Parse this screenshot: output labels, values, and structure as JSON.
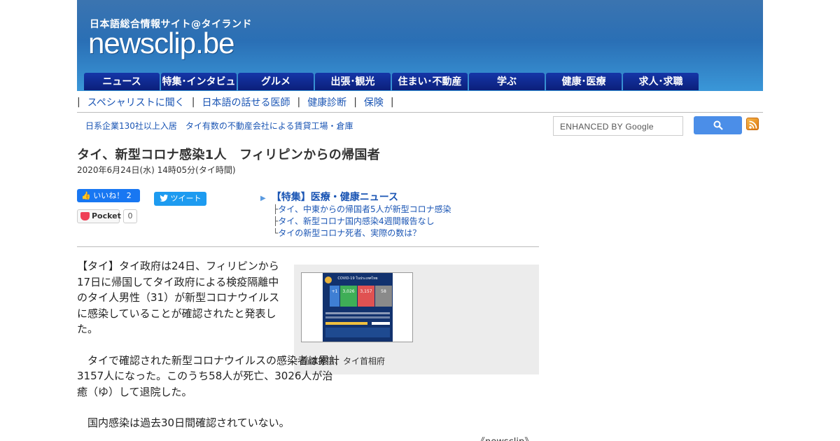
{
  "header": {
    "tagline": "日本語総合情報サイト@タイランド",
    "logo": "newsclip.be"
  },
  "nav": {
    "tabs": [
      {
        "label": "ニュース"
      },
      {
        "label": "特集･インタビュー"
      },
      {
        "label": "グルメ"
      },
      {
        "label": "出張･観光"
      },
      {
        "label": "住まい･不動産"
      },
      {
        "label": "学ぶ"
      },
      {
        "label": "健康･医療"
      },
      {
        "label": "求人･求職"
      }
    ]
  },
  "subnav": {
    "links": [
      {
        "label": "スペシャリストに聞く"
      },
      {
        "label": "日本語の話せる医師"
      },
      {
        "label": "健康診断"
      },
      {
        "label": "保険"
      }
    ]
  },
  "ad": {
    "text": "日系企業130社以上入居　タイ有数の不動産会社による賃貸工場・倉庫"
  },
  "search": {
    "placeholder": "ENHANCED BY Google",
    "icon": "search-icon"
  },
  "article": {
    "title": "タイ、新型コロナ感染1人　フィリピンからの帰国者",
    "date": "2020年6月24日(水) 14時05分(タイ時間)",
    "paragraphs": [
      "【タイ】タイ政府は24日、フィリピンから17日に帰国してタイ政府による検疫隔離中のタイ人男性（31）が新型コロナウイルスに感染していることが確認されたと発表した。",
      "　タイで確認された新型コロナウイルスの感染者は累計3157人になった。このうち58人が死亡、3026人が治癒（ゆ）して退院した。",
      "　国内感染は過去30日間確認されていない。"
    ],
    "source": "《newsclip》"
  },
  "social": {
    "like_label": "いいね！ 2",
    "tweet_label": "ツイート",
    "pocket_label": "Pocket",
    "pocket_count": "0"
  },
  "related": {
    "heading": "【特集】医療・健康ニュース",
    "items": [
      {
        "prefix": "├",
        "label": "タイ、中東からの帰国者5人が新型コロナ感染"
      },
      {
        "prefix": "├",
        "label": "タイ、新型コロナ国内感染4週間報告なし"
      },
      {
        "prefix": "└",
        "label": "タイの新型コロナ死者、実際の数は？"
      }
    ]
  },
  "figure": {
    "caption": "画像提供、タイ首相府",
    "infographic": {
      "title": "COVID-19 ในประเทศไทย",
      "new": "+1",
      "recovered": "3,026",
      "total": "3,157",
      "deaths": "58"
    }
  },
  "colors": {
    "header_top": "#3b74b0",
    "header_bottom": "#3a97d8",
    "nav_tab": "#0b1f7a",
    "link": "#1a55b4",
    "facebook": "#1877f2",
    "twitter": "#1d9bf0",
    "pocket": "#ef4056",
    "search_button": "#4b8ee8"
  }
}
